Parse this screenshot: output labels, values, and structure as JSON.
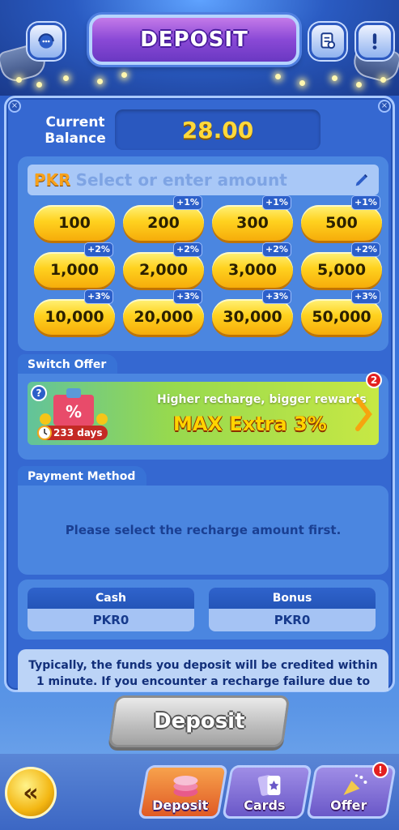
{
  "header": {
    "title": "DEPOSIT",
    "left_icon": "customer-service-icon",
    "right_icons": [
      "record-list-icon",
      "info-alert-icon"
    ]
  },
  "balance": {
    "label": "Current Balance",
    "value": "28.00"
  },
  "amount": {
    "currency": "PKR",
    "placeholder": "Select or enter amount",
    "options": [
      {
        "value": "100",
        "bonus": ""
      },
      {
        "value": "200",
        "bonus": "+1%"
      },
      {
        "value": "300",
        "bonus": "+1%"
      },
      {
        "value": "500",
        "bonus": "+1%"
      },
      {
        "value": "1,000",
        "bonus": "+2%"
      },
      {
        "value": "2,000",
        "bonus": "+2%"
      },
      {
        "value": "3,000",
        "bonus": "+2%"
      },
      {
        "value": "5,000",
        "bonus": "+2%"
      },
      {
        "value": "10,000",
        "bonus": "+3%"
      },
      {
        "value": "20,000",
        "bonus": "+3%"
      },
      {
        "value": "30,000",
        "bonus": "+3%"
      },
      {
        "value": "50,000",
        "bonus": "+3%"
      }
    ]
  },
  "offer": {
    "section_title": "Switch Offer",
    "subtitle": "Higher recharge, bigger rewards",
    "headline": "MAX Extra  3%",
    "days": "233 days",
    "badge_count": "2",
    "help": "?"
  },
  "payment": {
    "section_title": "Payment Method",
    "message": "Please select the recharge amount first."
  },
  "wallet": {
    "cash_label": "Cash",
    "cash_value": "PKR0",
    "bonus_label": "Bonus",
    "bonus_value": "PKR0"
  },
  "note": {
    "text": "Typically, the funds you deposit will be credited within 1 minute. If you encounter a recharge failure due to channel fluctuations, we"
  },
  "actions": {
    "deposit_label": "Deposit"
  },
  "bottom_nav": {
    "back": "«",
    "tabs": [
      {
        "label": "Deposit",
        "icon": "chips-icon",
        "active": true
      },
      {
        "label": "Cards",
        "icon": "cards-icon",
        "active": false
      },
      {
        "label": "Offer",
        "icon": "party-popper-icon",
        "active": false,
        "alert": "!"
      }
    ]
  },
  "colors": {
    "accent_gold": "#ffd93b",
    "panel_blue": "#3568d1",
    "title_purple": "#8a49d6"
  }
}
